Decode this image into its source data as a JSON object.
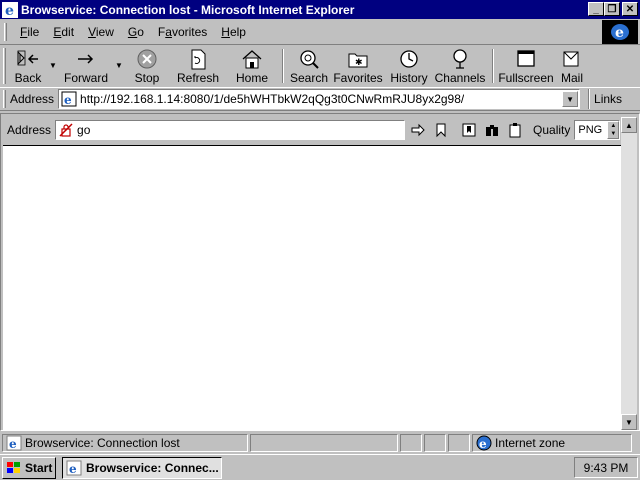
{
  "window": {
    "title": "Browservice: Connection lost - Microsoft Internet Explorer",
    "controls": {
      "minimize": "_",
      "maximize": "❐",
      "close": "✕"
    }
  },
  "menu": {
    "items": [
      {
        "key": "F",
        "rest": "ile"
      },
      {
        "key": "E",
        "rest": "dit"
      },
      {
        "key": "V",
        "rest": "iew"
      },
      {
        "key": "G",
        "rest": "o"
      },
      {
        "key": "F",
        "rest": "a",
        "pre": "",
        "label": "Favorites"
      },
      {
        "key": "H",
        "rest": "elp"
      }
    ],
    "favorites_pre": "F",
    "favorites_u": "a",
    "favorites_post": "vorites"
  },
  "toolbar": {
    "back": "Back",
    "forward": "Forward",
    "stop": "Stop",
    "refresh": "Refresh",
    "home": "Home",
    "search": "Search",
    "favorites": "Favorites",
    "history": "History",
    "channels": "Channels",
    "fullscreen": "Fullscreen",
    "mail": "Mail"
  },
  "address_bar": {
    "label": "Address",
    "url": "http://192.168.1.14:8080/1/de5hWHTbkW2qQg3t0CNwRmRJU8yx2g98/",
    "links": "Links"
  },
  "inner_toolbar": {
    "address_label": "Address",
    "address_value": "go",
    "quality_label": "Quality",
    "quality_value": "PNG"
  },
  "status_bar": {
    "text": "Browservice: Connection lost",
    "zone": "Internet zone"
  },
  "taskbar": {
    "start": "Start",
    "task": "Browservice: Connec...",
    "clock": "9:43 PM"
  },
  "colors": {
    "titlebar": "#000080",
    "face": "#c0c0c0",
    "canvas": "#ffffff"
  }
}
